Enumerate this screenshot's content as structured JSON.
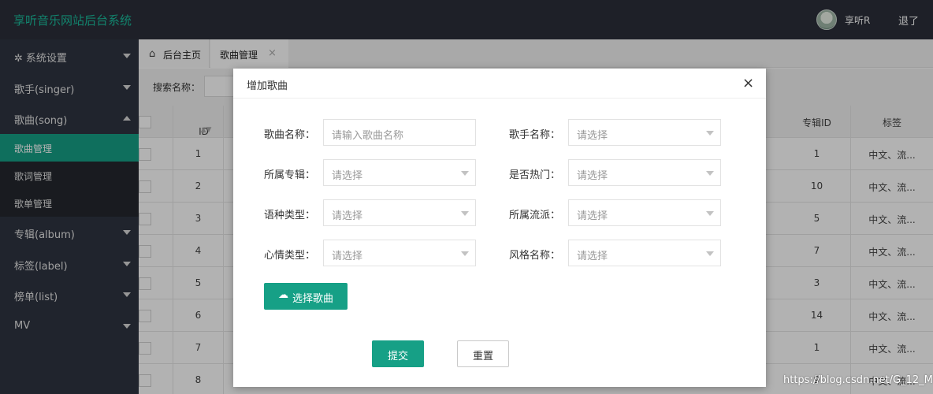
{
  "header": {
    "title": "享听音乐网站后台系统",
    "username": "享听R",
    "logout": "退了"
  },
  "sidebar": {
    "items": [
      {
        "label": "系统设置",
        "icon": "gear-icon"
      },
      {
        "label": "歌手(singer)"
      },
      {
        "label": "歌曲(song)"
      },
      {
        "label": "歌曲管理"
      },
      {
        "label": "歌词管理"
      },
      {
        "label": "歌单管理"
      },
      {
        "label": "专辑(album)"
      },
      {
        "label": "标签(label)"
      },
      {
        "label": "榜单(list)"
      },
      {
        "label": "MV"
      }
    ]
  },
  "tabs": [
    {
      "label": "后台主页",
      "icon": "home-icon"
    },
    {
      "label": "歌曲管理",
      "close": "×"
    }
  ],
  "search": {
    "label": "搜索名称："
  },
  "table": {
    "headers": {
      "id": "ID",
      "album_id": "专辑ID",
      "tag": "标签"
    },
    "rows": [
      {
        "id": "1",
        "album_id": "1",
        "tag": "中文、流..."
      },
      {
        "id": "2",
        "album_id": "10",
        "tag": "中文、流..."
      },
      {
        "id": "3",
        "album_id": "5",
        "tag": "中文、流..."
      },
      {
        "id": "4",
        "album_id": "7",
        "tag": "中文、流..."
      },
      {
        "id": "5",
        "album_id": "3",
        "tag": "中文、流..."
      },
      {
        "id": "6",
        "album_id": "14",
        "tag": "中文、流..."
      },
      {
        "id": "7",
        "album_id": "1",
        "tag": "中文、流..."
      },
      {
        "id": "8",
        "album_id": "9",
        "tag": "中文、流..."
      }
    ]
  },
  "modal": {
    "title": "增加歌曲",
    "close": "×",
    "fields": [
      {
        "label": "歌曲名称：",
        "placeholder": "请输入歌曲名称"
      },
      {
        "label": "歌手名称：",
        "placeholder": "请选择"
      },
      {
        "label": "所属专辑：",
        "placeholder": "请选择"
      },
      {
        "label": "是否热门：",
        "placeholder": "请选择"
      },
      {
        "label": "语种类型：",
        "placeholder": "请选择"
      },
      {
        "label": "所属流派：",
        "placeholder": "请选择"
      },
      {
        "label": "心情类型：",
        "placeholder": "请选择"
      },
      {
        "label": "风格名称：",
        "placeholder": "请选择"
      }
    ],
    "upload_label": "选择歌曲",
    "submit_label": "提交",
    "reset_label": "重置"
  },
  "watermark": "https://blog.csdn.net/G_12_M",
  "colors": {
    "accent": "#16a086",
    "header_bg": "#2b2f3a",
    "sidebar_bg": "#2f3441",
    "brand": "#1abc9c"
  }
}
